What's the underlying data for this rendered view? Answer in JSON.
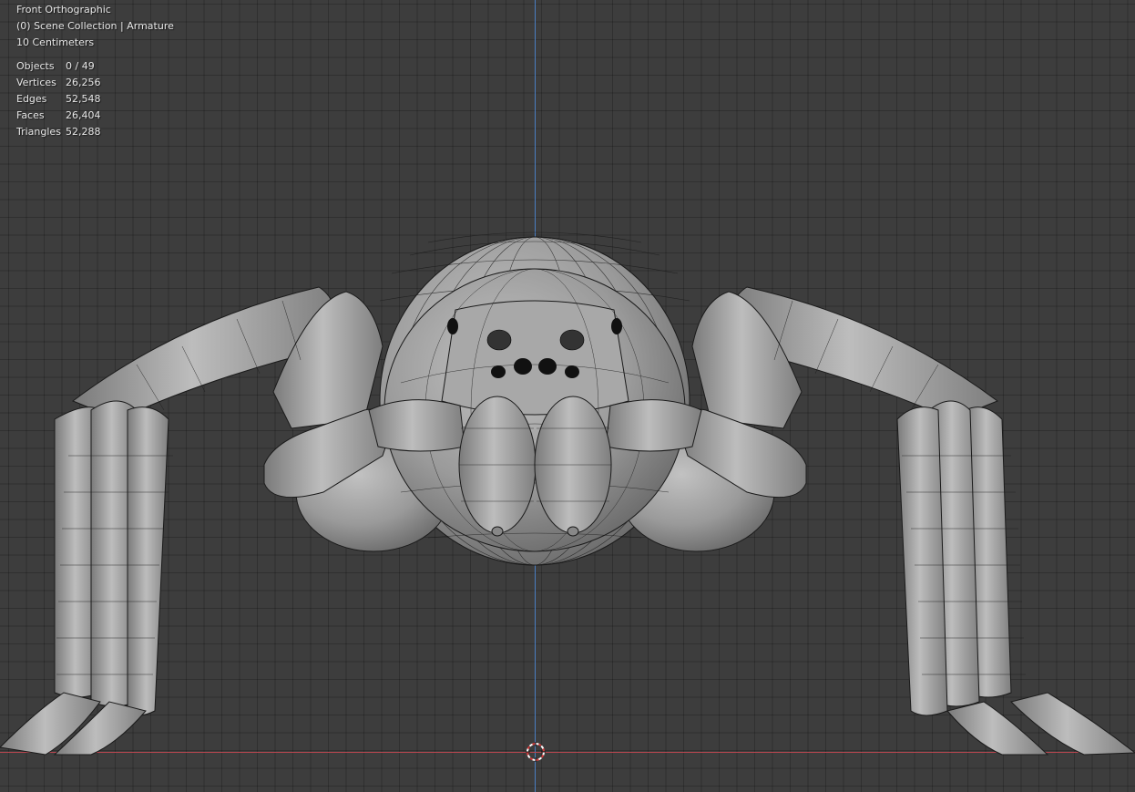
{
  "viewport": {
    "view_name": "Front Orthographic",
    "collection": "(0) Scene Collection | Armature",
    "grid_scale": "10 Centimeters"
  },
  "stats": [
    {
      "label": "Objects",
      "value": "0 / 49"
    },
    {
      "label": "Vertices",
      "value": "26,256"
    },
    {
      "label": "Edges",
      "value": "52,548"
    },
    {
      "label": "Faces",
      "value": "26,404"
    },
    {
      "label": "Triangles",
      "value": "52,288"
    }
  ],
  "colors": {
    "background": "#3d3d3d",
    "axis_x": "#b8454f",
    "axis_z": "#4a7ec2",
    "mesh_fill": "#9a9a9a",
    "wire": "#1a1a1a"
  },
  "icons": {
    "cursor": "3d-cursor-icon"
  }
}
